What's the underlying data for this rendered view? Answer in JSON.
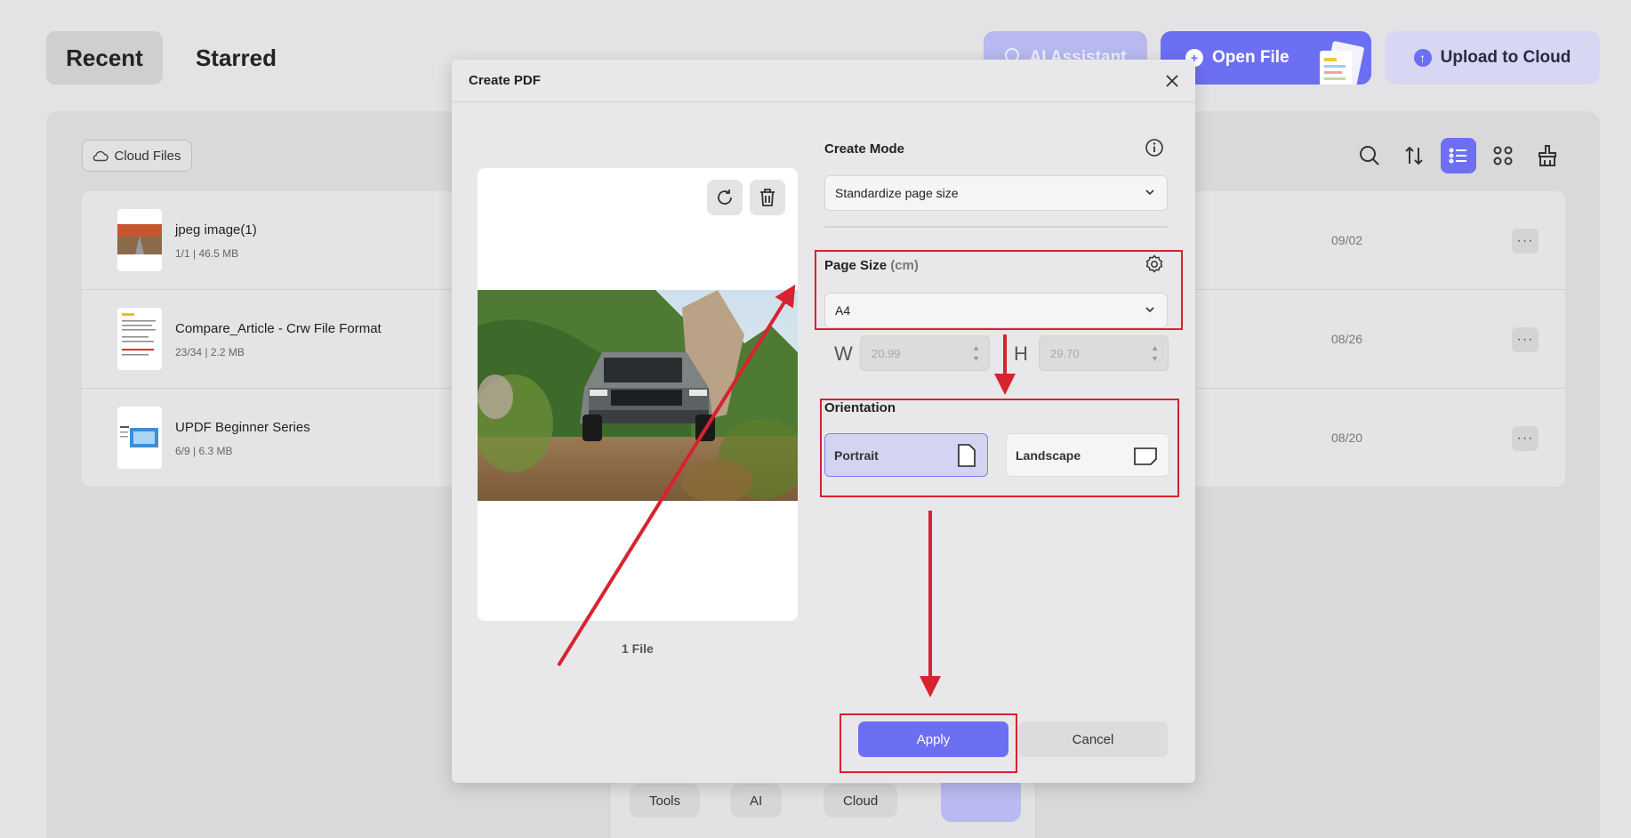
{
  "app": {
    "tabs": {
      "recent": "Recent",
      "starred": "Starred"
    },
    "ai_assistant_label": "AI Assistant",
    "open_file_label": "Open File",
    "upload_label": "Upload to Cloud",
    "cloud_files_label": "Cloud Files",
    "files": [
      {
        "name": "jpeg image(1)",
        "meta": "1/1 | 46.5 MB",
        "date": "09/02"
      },
      {
        "name": "Compare_Article - Crw File Format",
        "meta": "23/34 | 2.2 MB",
        "date": "08/26"
      },
      {
        "name": "UPDF Beginner Series",
        "meta": "6/9 | 6.3 MB",
        "date": "08/20"
      }
    ],
    "bottom_tabs": {
      "tools": "Tools",
      "ai": "AI",
      "cloud": "Cloud"
    },
    "accent_color": "#6d6ff2"
  },
  "dialog": {
    "title": "Create PDF",
    "file_count": "1 File",
    "create_mode_label": "Create Mode",
    "create_mode_value": "Standardize page size",
    "page_size_label": "Page Size",
    "page_size_unit": "(cm)",
    "page_size_value": "A4",
    "width_letter": "W",
    "height_letter": "H",
    "width_value": "20.99",
    "height_value": "29.70",
    "orientation_label": "Orientation",
    "portrait_label": "Portrait",
    "landscape_label": "Landscape",
    "selected_orientation": "Portrait",
    "apply_label": "Apply",
    "cancel_label": "Cancel"
  },
  "annotation_color": "#d8222f"
}
